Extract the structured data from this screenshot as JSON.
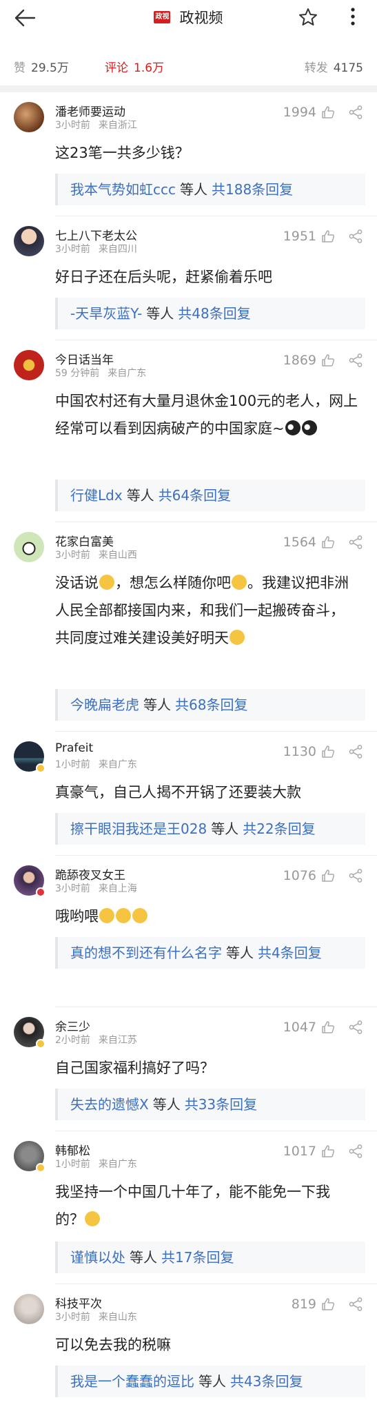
{
  "header": {
    "logo_text": "政视",
    "title": "政视频"
  },
  "stats": {
    "likes_label": "赞",
    "likes_value": "29.5万",
    "comments_label": "评论",
    "comments_value": "1.6万",
    "reposts_label": "转发",
    "reposts_value": "4175"
  },
  "comments": [
    {
      "user": "潘老师要运动",
      "time": "3小时前",
      "location": "来自浙江",
      "likes": "1994",
      "text": "这23笔一共多少钱？",
      "reply_user": "我本气势如虹ccc",
      "reply_mid": "等人",
      "reply_count": "共188条回复"
    },
    {
      "user": "七上八下老太公",
      "time": "3小时前",
      "location": "来自四川",
      "likes": "1951",
      "text": "好日子还在后头呢，赶紧偷着乐吧",
      "reply_user": "-天旱灰蓝Y-",
      "reply_mid": "等人",
      "reply_count": "共48条回复"
    },
    {
      "user": "今日话当年",
      "time": "59 分钟前",
      "location": "来自广东",
      "likes": "1869",
      "text": "中国农村还有大量月退休金100元的老人，网上经常可以看到因病破产的中国家庭~",
      "reply_user": "行健Ldx",
      "reply_mid": "等人",
      "reply_count": "共64条回复"
    },
    {
      "user": "花家白富美",
      "time": "3小时前",
      "location": "来自山西",
      "likes": "1564",
      "text_parts": [
        "没话说",
        "，想怎么样随你吧",
        "。我建议把非洲人民全部都接国内来，和我们一起搬砖奋斗，共同度过难关建设美好明天"
      ],
      "reply_user": "今晚扁老虎",
      "reply_mid": "等人",
      "reply_count": "共68条回复"
    },
    {
      "user": "Prafeit",
      "time": "1小时前",
      "location": "来自广东",
      "likes": "1130",
      "text": "真豪气，自己人揭不开锅了还要装大款",
      "reply_user": "擦干眼泪我还是王028",
      "reply_mid": "等人",
      "reply_count": "共22条回复"
    },
    {
      "user": "跪舔夜叉女王",
      "time": "3小时前",
      "location": "来自上海",
      "likes": "1076",
      "text": "哦哟喂",
      "reply_user": "真的想不到还有什么名字",
      "reply_mid": "等人",
      "reply_count": "共4条回复"
    },
    {
      "user": "余三少",
      "time": "2小时前",
      "location": "来自江苏",
      "likes": "1047",
      "text": "自己国家福利搞好了吗？",
      "reply_user": "失去的遗憾X",
      "reply_mid": "等人",
      "reply_count": "共33条回复"
    },
    {
      "user": "韩郁松",
      "time": "1小时前",
      "location": "来自广东",
      "likes": "1017",
      "text": "我坚持一个中国几十年了，能不能免一下我的？",
      "reply_user": "谨慎以处",
      "reply_mid": "等人",
      "reply_count": "共17条回复"
    },
    {
      "user": "科技平次",
      "time": "3小时前",
      "location": "来自山东",
      "likes": "819",
      "text": "可以免去我的税嘛",
      "reply_user": "我是一个蠢蠢的逗比",
      "reply_mid": "等人",
      "reply_count": "共43条回复"
    }
  ],
  "colors": {
    "accent": "#d71e1e",
    "link": "#3b6fc4",
    "muted": "#999999"
  },
  "icons": {
    "back": "arrow-left-icon",
    "star": "star-icon",
    "more": "more-vertical-icon",
    "like": "thumbs-up-icon",
    "share": "share-icon"
  }
}
